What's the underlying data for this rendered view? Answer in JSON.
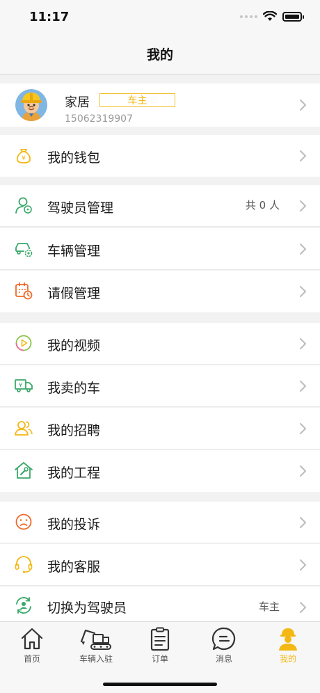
{
  "status_bar": {
    "time": "11:17"
  },
  "nav": {
    "title": "我的"
  },
  "profile": {
    "name": "家居",
    "role": "车主",
    "phone": "15062319907"
  },
  "menu": {
    "wallet": "我的钱包",
    "drivers": "驾驶员管理",
    "drivers_count": "共 0 人",
    "vehicles": "车辆管理",
    "leave": "请假管理",
    "videos": "我的视频",
    "sold_cars": "我卖的车",
    "recruit": "我的招聘",
    "projects": "我的工程",
    "complaints": "我的投诉",
    "service": "我的客服",
    "switch_role": "切换为驾驶员",
    "current_role": "车主"
  },
  "tabs": [
    {
      "label": "首页"
    },
    {
      "label": "车辆入驻"
    },
    {
      "label": "订单"
    },
    {
      "label": "消息"
    },
    {
      "label": "我的"
    }
  ],
  "colors": {
    "accent": "#f3b814",
    "badge_border": "#f3bf2d",
    "green": "#3aa86a",
    "orange": "#f06a2a"
  }
}
